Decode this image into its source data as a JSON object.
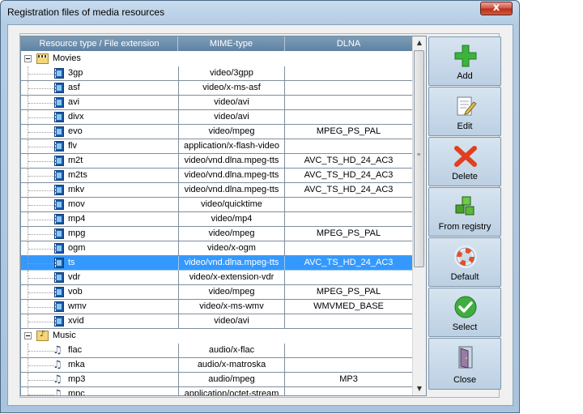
{
  "window": {
    "title": "Registration files of media resources",
    "close_label": "x"
  },
  "table": {
    "columns": [
      "Resource type / File extension",
      "MIME-type",
      "DLNA"
    ],
    "rows": [
      {
        "kind": "group",
        "name": "Movies",
        "icon": "movies-folder-icon"
      },
      {
        "kind": "file",
        "name": "3gp",
        "mime": "video/3gpp",
        "dlna": ""
      },
      {
        "kind": "file",
        "name": "asf",
        "mime": "video/x-ms-asf",
        "dlna": ""
      },
      {
        "kind": "file",
        "name": "avi",
        "mime": "video/avi",
        "dlna": ""
      },
      {
        "kind": "file",
        "name": "divx",
        "mime": "video/avi",
        "dlna": ""
      },
      {
        "kind": "file",
        "name": "evo",
        "mime": "video/mpeg",
        "dlna": "MPEG_PS_PAL"
      },
      {
        "kind": "file",
        "name": "flv",
        "mime": "application/x-flash-video",
        "dlna": ""
      },
      {
        "kind": "file",
        "name": "m2t",
        "mime": "video/vnd.dlna.mpeg-tts",
        "dlna": "AVC_TS_HD_24_AC3"
      },
      {
        "kind": "file",
        "name": "m2ts",
        "mime": "video/vnd.dlna.mpeg-tts",
        "dlna": "AVC_TS_HD_24_AC3"
      },
      {
        "kind": "file",
        "name": "mkv",
        "mime": "video/vnd.dlna.mpeg-tts",
        "dlna": "AVC_TS_HD_24_AC3"
      },
      {
        "kind": "file",
        "name": "mov",
        "mime": "video/quicktime",
        "dlna": ""
      },
      {
        "kind": "file",
        "name": "mp4",
        "mime": "video/mp4",
        "dlna": ""
      },
      {
        "kind": "file",
        "name": "mpg",
        "mime": "video/mpeg",
        "dlna": "MPEG_PS_PAL"
      },
      {
        "kind": "file",
        "name": "ogm",
        "mime": "video/x-ogm",
        "dlna": ""
      },
      {
        "kind": "file",
        "name": "ts",
        "mime": "video/vnd.dlna.mpeg-tts",
        "dlna": "AVC_TS_HD_24_AC3",
        "selected": true
      },
      {
        "kind": "file",
        "name": "vdr",
        "mime": "video/x-extension-vdr",
        "dlna": ""
      },
      {
        "kind": "file",
        "name": "vob",
        "mime": "video/mpeg",
        "dlna": "MPEG_PS_PAL"
      },
      {
        "kind": "file",
        "name": "wmv",
        "mime": "video/x-ms-wmv",
        "dlna": "WMVMED_BASE"
      },
      {
        "kind": "file",
        "name": "xvid",
        "mime": "video/avi",
        "dlna": ""
      },
      {
        "kind": "group",
        "name": "Music",
        "icon": "music-folder-icon"
      },
      {
        "kind": "file",
        "name": "flac",
        "mime": "audio/x-flac",
        "dlna": "",
        "icon": "music-note-icon"
      },
      {
        "kind": "file",
        "name": "mka",
        "mime": "audio/x-matroska",
        "dlna": "",
        "icon": "music-note-icon"
      },
      {
        "kind": "file",
        "name": "mp3",
        "mime": "audio/mpeg",
        "dlna": "MP3",
        "icon": "music-note-icon"
      },
      {
        "kind": "file",
        "name": "mpc",
        "mime": "application/octet-stream",
        "dlna": "",
        "icon": "music-note-icon"
      }
    ]
  },
  "toolbar": {
    "add": "Add",
    "edit": "Edit",
    "delete": "Delete",
    "from_registry": "From registry",
    "default": "Default",
    "select": "Select",
    "close": "Close"
  },
  "colors": {
    "selection": "#3399ff",
    "header": "#6a8cab",
    "add_green": "#3db33d",
    "delete_red": "#e04020"
  }
}
